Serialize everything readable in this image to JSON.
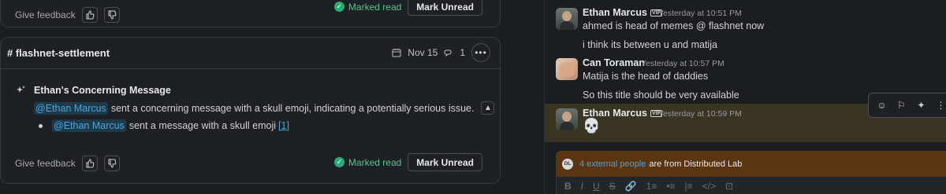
{
  "left": {
    "top_card": {
      "feedback_label": "Give feedback",
      "marked_read_label": "Marked read",
      "mark_unread_label": "Mark Unread"
    },
    "main_card": {
      "channel": "# flashnet-settlement",
      "date": "Nov 15",
      "thread_count": "1",
      "more_label": "•••",
      "summary_title": "Ethan's Concerning Message",
      "summary_mention": "@Ethan Marcus",
      "summary_text": "sent a concerning message with a skull emoji, indicating a potentially serious issue.",
      "bullet_mention": "@Ethan Marcus",
      "bullet_text": "sent a message with a skull emoji",
      "bullet_ref": "[1]",
      "feedback_label": "Give feedback",
      "marked_read_label": "Marked read",
      "mark_unread_label": "Mark Unread"
    }
  },
  "right": {
    "messages": [
      {
        "name": "Ethan Marcus",
        "vip": "VIP",
        "time": "Yesterday at 10:51 PM",
        "lines": [
          "ahmed is head of memes @ flashnet now",
          "i think its between u and matija"
        ]
      },
      {
        "name": "Can Toraman",
        "time": "Yesterday at 10:57 PM",
        "lines": [
          "Matija is the head of daddies",
          "So this title should be very available"
        ]
      },
      {
        "name": "Ethan Marcus",
        "vip": "VIP",
        "time": "Yesterday at 10:59 PM",
        "emoji": "💀"
      }
    ],
    "banner": {
      "badge": "DL",
      "link_text": "4 external people",
      "rest_text": "are from Distributed Lab"
    },
    "composer_icons": [
      "B",
      "I",
      "U",
      "S",
      "🔗",
      "1≡",
      "•≡",
      "|≡",
      "</>",
      "⊡"
    ]
  }
}
